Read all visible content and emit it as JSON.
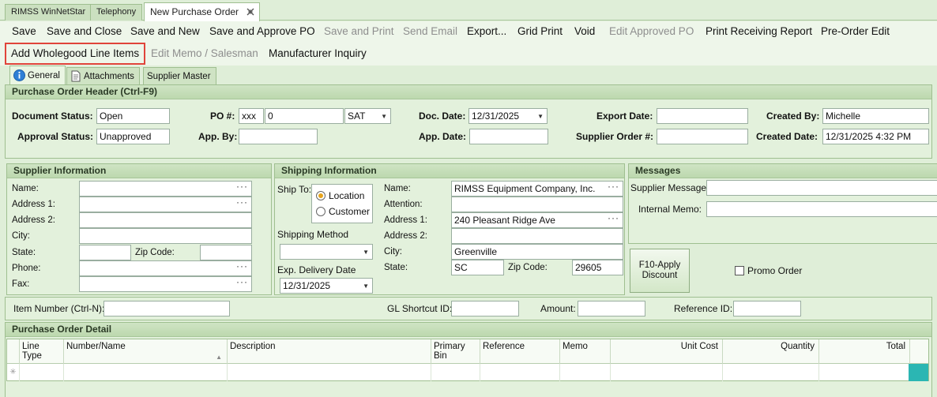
{
  "doc_tabs": [
    "RIMSS WinNetStar",
    "Telephony",
    "New Purchase Order"
  ],
  "toolbar": {
    "row1": [
      {
        "label": "Save",
        "enabled": true
      },
      {
        "label": "Save and Close",
        "enabled": true
      },
      {
        "label": "Save and New",
        "enabled": true
      },
      {
        "label": "Save and Approve PO",
        "enabled": true
      },
      {
        "label": "Save and Print",
        "enabled": false
      },
      {
        "label": "Send Email",
        "enabled": false
      },
      {
        "label": "Export...",
        "enabled": true
      },
      {
        "label": "Grid Print",
        "enabled": true
      },
      {
        "label": "Void",
        "enabled": true
      },
      {
        "label": "Edit Approved PO",
        "enabled": false
      },
      {
        "label": "Print Receiving Report",
        "enabled": true
      },
      {
        "label": "Pre-Order Edit",
        "enabled": true
      }
    ],
    "row2": [
      {
        "label": "Add Wholegood Line Items",
        "enabled": true
      },
      {
        "label": "Edit Memo / Salesman",
        "enabled": false
      },
      {
        "label": "Manufacturer Inquiry",
        "enabled": true
      }
    ]
  },
  "sub_tabs": [
    "General",
    "Attachments",
    "Supplier Master"
  ],
  "header": {
    "title": "Purchase Order Header (Ctrl-F9)",
    "document_status_label": "Document Status:",
    "document_status": "Open",
    "approval_status_label": "Approval Status:",
    "approval_status": "Unapproved",
    "po_label": "PO #:",
    "po_prefix": "xxx",
    "po_number": "0",
    "po_location": "SAT",
    "app_by_label": "App. By:",
    "app_by": "",
    "doc_date_label": "Doc. Date:",
    "doc_date": "12/31/2025",
    "app_date_label": "App. Date:",
    "app_date": "",
    "export_date_label": "Export Date:",
    "export_date": "",
    "supplier_order_label": "Supplier Order #:",
    "supplier_order": "",
    "created_by_label": "Created By:",
    "created_by": "Michelle",
    "created_date_label": "Created Date:",
    "created_date": "12/31/2025 4:32 PM"
  },
  "supplier": {
    "title": "Supplier Information",
    "name_label": "Name:",
    "address1_label": "Address 1:",
    "address2_label": "Address 2:",
    "city_label": "City:",
    "state_label": "State:",
    "zip_label": "Zip Code:",
    "phone_label": "Phone:",
    "fax_label": "Fax:"
  },
  "shipping": {
    "title": "Shipping Information",
    "ship_to_label": "Ship To:",
    "option_location": "Location",
    "option_customer": "Customer",
    "method_label": "Shipping Method",
    "method": "",
    "exp_delivery_label": "Exp. Delivery Date",
    "exp_delivery": "12/31/2025",
    "name_label": "Name:",
    "name": "RIMSS Equipment Company, Inc.",
    "attention_label": "Attention:",
    "attention": "",
    "address1_label": "Address 1:",
    "address1": "240 Pleasant Ridge Ave",
    "address2_label": "Address 2:",
    "address2": "",
    "city_label": "City:",
    "city": "Greenville",
    "state_label": "State:",
    "state": "SC",
    "zip_label": "Zip Code:",
    "zip": "29605"
  },
  "messages": {
    "title": "Messages",
    "supplier_message_label": "Supplier Message:",
    "internal_memo_label": "Internal Memo:",
    "discount_button": "F10-Apply Discount",
    "promo_order_label": "Promo Order"
  },
  "item_bar": {
    "item_number_label": "Item Number (Ctrl-N):",
    "gl_shortcut_label": "GL Shortcut ID:",
    "amount_label": "Amount:",
    "reference_label": "Reference ID:"
  },
  "detail": {
    "title": "Purchase Order Detail",
    "columns": [
      "Line Type",
      "Number/Name",
      "Description",
      "Primary Bin",
      "Reference",
      "Memo",
      "Unit Cost",
      "Quantity",
      "Total"
    ]
  }
}
